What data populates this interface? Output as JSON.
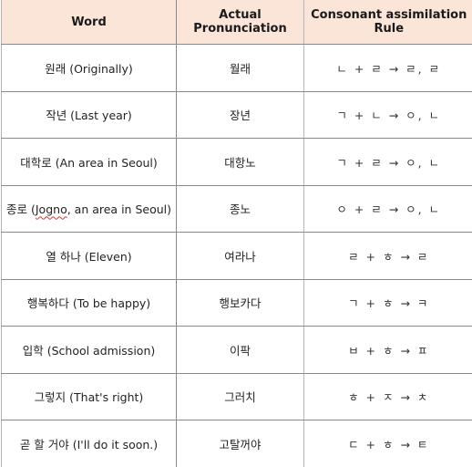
{
  "table": {
    "header_bg": "#fbe4d8",
    "columns": [
      "Word",
      "Actual Pronunciation",
      "Consonant assimilation Rule"
    ],
    "rows": [
      {
        "word": "원래 (Originally)",
        "pronunciation": "월래",
        "rule": "ㄴ + ㄹ → ㄹ, ㄹ"
      },
      {
        "word": "작년 (Last year)",
        "pronunciation": "장년",
        "rule": "ㄱ + ㄴ → ㅇ, ㄴ"
      },
      {
        "word": "대학로 (An area in Seoul)",
        "pronunciation": "대항노",
        "rule": "ㄱ + ㄹ → ㅇ, ㄴ"
      },
      {
        "word_prefix": "종로 (",
        "word_marked": "Jogno",
        "word_suffix": ", an area in Seoul)",
        "pronunciation": "종노",
        "rule": "ㅇ + ㄹ → ㅇ, ㄴ"
      },
      {
        "word": "열 하나 (Eleven)",
        "pronunciation": "여라나",
        "rule": "ㄹ + ㅎ → ㄹ"
      },
      {
        "word": "행복하다 (To be happy)",
        "pronunciation": "행보카다",
        "rule": "ㄱ + ㅎ → ㅋ"
      },
      {
        "word": "입학 (School admission)",
        "pronunciation": "이팍",
        "rule": "ㅂ + ㅎ → ㅍ"
      },
      {
        "word": "그렇지 (That's right)",
        "pronunciation": "그러치",
        "rule": "ㅎ + ㅈ → ㅊ"
      },
      {
        "word": "곧 할 거야 (I'll do it soon.)",
        "pronunciation": "고탈꺼야",
        "rule": "ㄷ + ㅎ → ㅌ"
      }
    ]
  }
}
